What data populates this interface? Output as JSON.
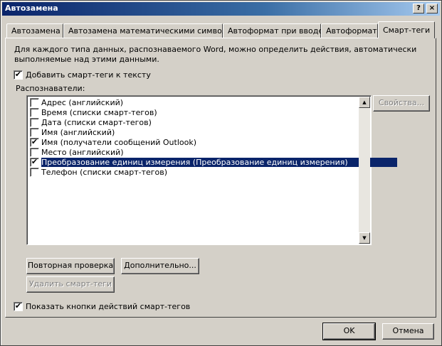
{
  "window": {
    "title": "Автозамена",
    "help_button": "?",
    "close_button": "×"
  },
  "tabs": [
    {
      "label": "Автозамена",
      "active": false
    },
    {
      "label": "Автозамена математическими символами",
      "active": false
    },
    {
      "label": "Автоформат при вводе",
      "active": false
    },
    {
      "label": "Автоформат",
      "active": false
    },
    {
      "label": "Смарт-теги",
      "active": true
    }
  ],
  "panel": {
    "description": "Для каждого типа данных, распознаваемого Word, можно определить действия, автоматически выполняемые над этими данными.",
    "add_tags_checkbox": {
      "label": "Добавить смарт-теги к тексту",
      "checked": true
    },
    "recognizers_label": "Распознаватели:",
    "recognizers": [
      {
        "label": "Адрес (английский)",
        "checked": false,
        "selected": false
      },
      {
        "label": "Время (списки смарт-тегов)",
        "checked": false,
        "selected": false
      },
      {
        "label": "Дата (списки смарт-тегов)",
        "checked": false,
        "selected": false
      },
      {
        "label": "Имя (английский)",
        "checked": false,
        "selected": false
      },
      {
        "label": "Имя (получатели сообщений Outlook)",
        "checked": true,
        "selected": false
      },
      {
        "label": "Место (английский)",
        "checked": false,
        "selected": false
      },
      {
        "label": "Преобразование единиц измерения (Преобразование единиц измерения)",
        "checked": true,
        "selected": true
      },
      {
        "label": "Телефон (списки смарт-тегов)",
        "checked": false,
        "selected": false
      }
    ],
    "properties_button": "Свойства...",
    "recheck_button": "Повторная проверка",
    "more_button": "Дополнительно...",
    "remove_tags_button": "Удалить смарт-теги",
    "show_buttons_checkbox": {
      "label": "Показать кнопки действий смарт-тегов",
      "checked": true
    }
  },
  "footer": {
    "ok_button": "OK",
    "cancel_button": "Отмена"
  }
}
